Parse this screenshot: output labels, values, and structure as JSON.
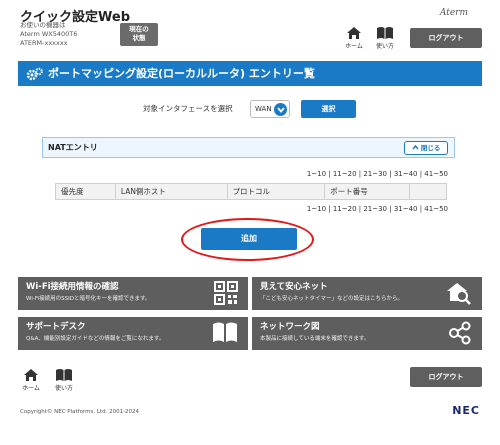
{
  "header": {
    "app_title": "クイック設定Web",
    "device_label": "お使いの機器は",
    "device_model": "Aterm WX5400T6",
    "device_id": "ATERM-xxxxxx",
    "status_button": [
      "現在の",
      "状態"
    ],
    "brand": "Aterm",
    "home_label": "ホーム",
    "manual_label": "使い方",
    "logout_label": "ログアウト"
  },
  "page": {
    "title": "ポートマッピング設定(ローカルルータ) エントリー覧",
    "interface_label": "対象インタフェースを選択",
    "interface_value": "WAN",
    "select_button": "選択"
  },
  "nat": {
    "section_title": "NATエントリ",
    "close_button": "閉じる",
    "pager_top": "1~10 | 11~20 | 21~30 | 31~40 | 41~50",
    "pager_bottom": "1~10 | 11~20 | 21~30 | 31~40 | 41~50",
    "columns": [
      "優先度",
      "LAN側ホスト",
      "プロトコル",
      "ポート番号"
    ],
    "add_button": "追加"
  },
  "tiles": [
    {
      "title": "Wi-Fi接続用情報の確認",
      "desc": "Wi-Fi接続用のSSIDと暗号化キーを確認できます。",
      "icon": "qr-code-icon"
    },
    {
      "title": "見えて安心ネット",
      "desc": "「こども安心ネットタイマー」などの設定はこちらから。",
      "icon": "house-search-icon"
    },
    {
      "title": "サポートデスク",
      "desc": "Q&A、機能別設定ガイドなどの情報をご覧になれます。",
      "icon": "book-icon"
    },
    {
      "title": "ネットワーク図",
      "desc": "本製品に接続している端末を確認できます。",
      "icon": "network-icon"
    }
  ],
  "footer": {
    "home_label": "ホーム",
    "manual_label": "使い方",
    "logout_label": "ログアウト",
    "copyright": "Copyright© NEC Platforms, Ltd. 2001-2024",
    "nec_logo": "NEC"
  },
  "colors": {
    "accent": "#1b7ac5",
    "tile": "#5e5e5e",
    "highlight": "#e01818"
  }
}
